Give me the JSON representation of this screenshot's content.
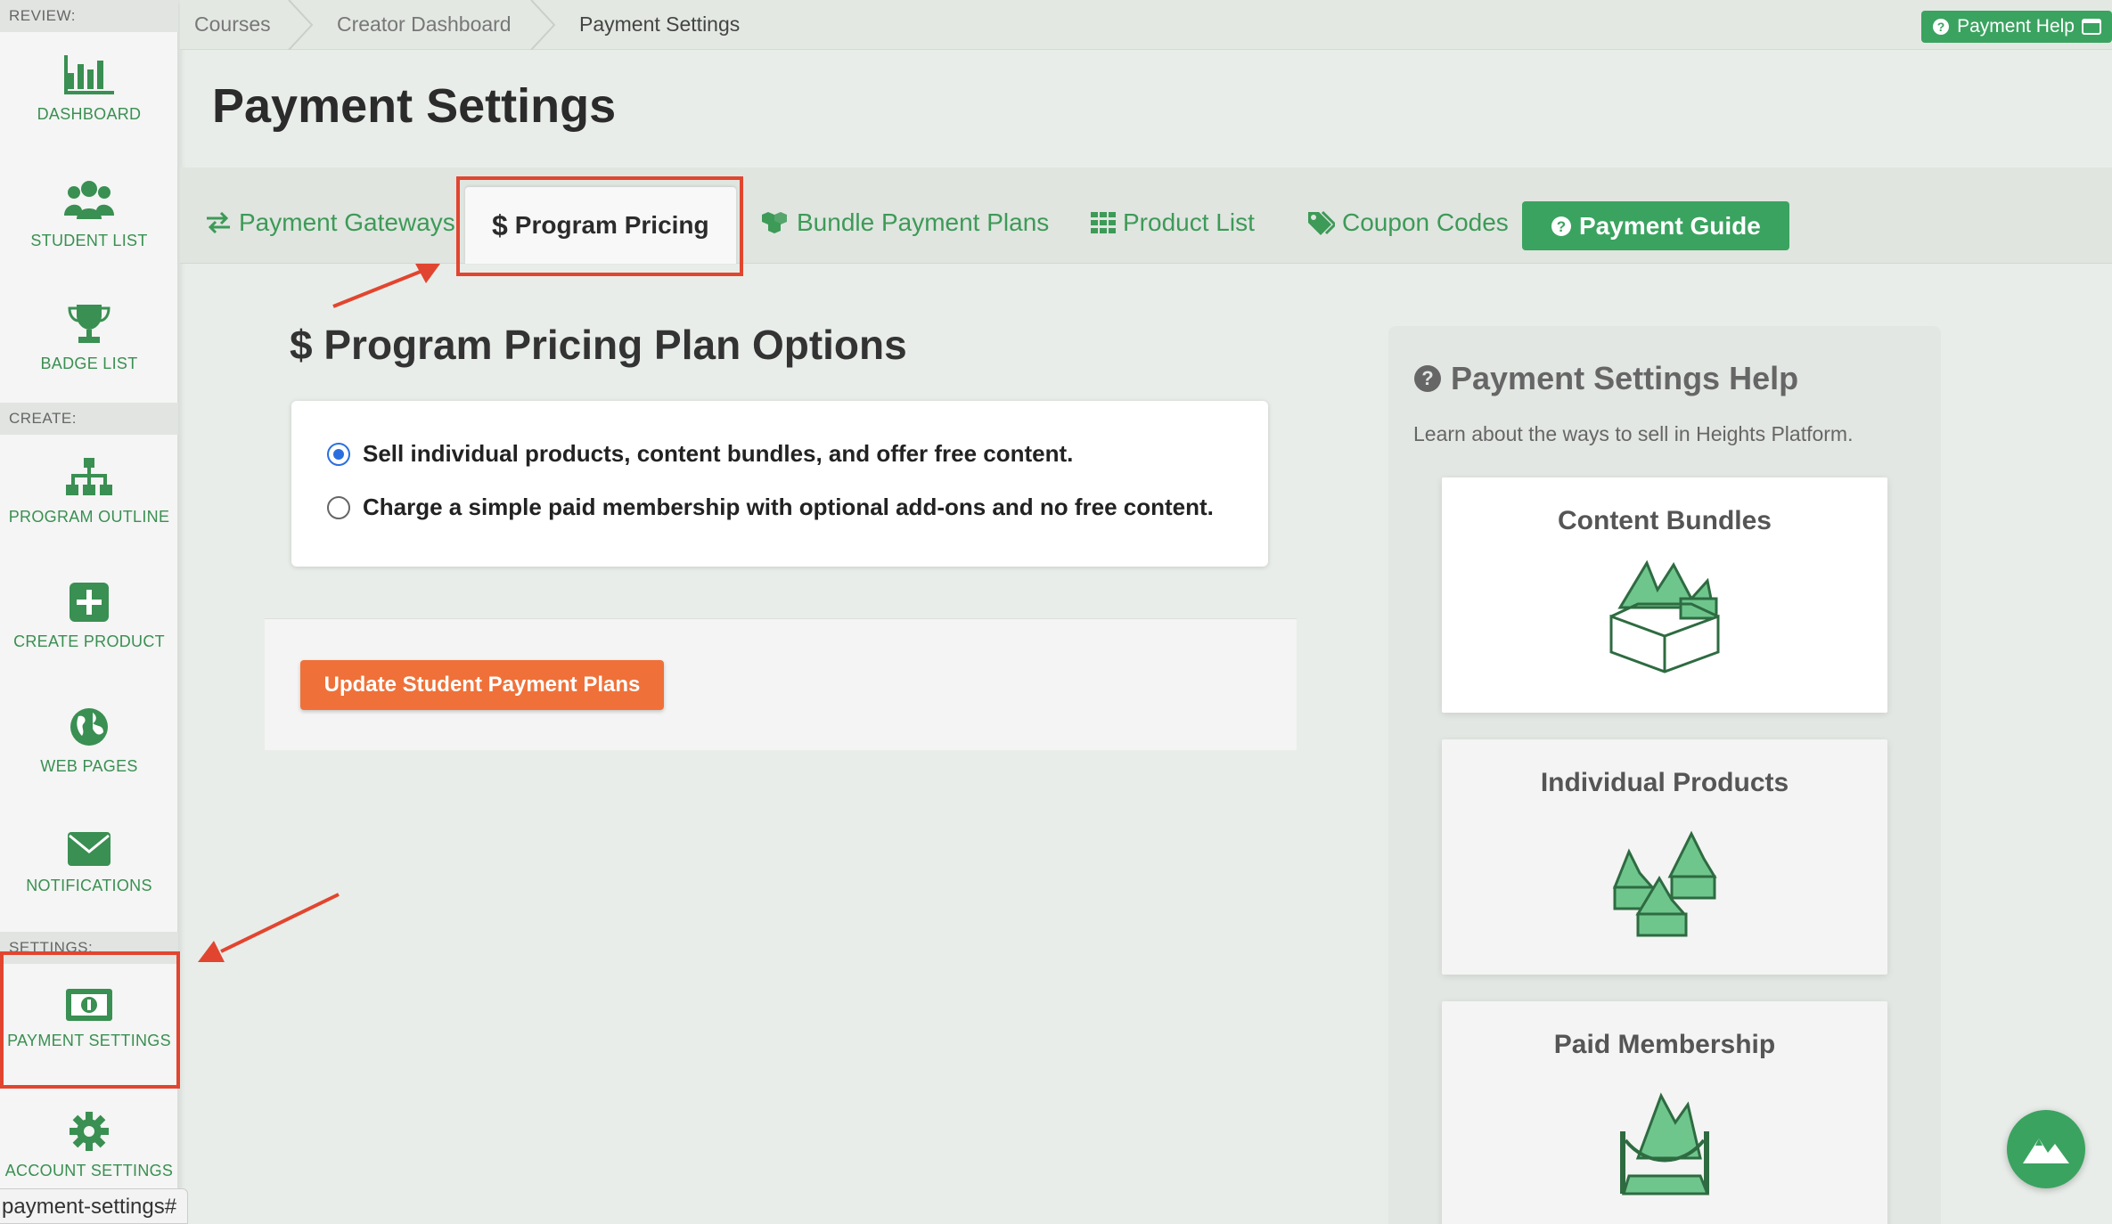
{
  "sidebar": {
    "sections": {
      "review": "REVIEW:",
      "create": "CREATE:",
      "settings": "SETTINGS:"
    },
    "items": [
      {
        "label": "DASHBOARD",
        "icon": "bar-chart-icon"
      },
      {
        "label": "STUDENT LIST",
        "icon": "users-icon"
      },
      {
        "label": "BADGE LIST",
        "icon": "trophy-icon"
      },
      {
        "label": "PROGRAM OUTLINE",
        "icon": "sitemap-icon"
      },
      {
        "label": "CREATE PRODUCT",
        "icon": "plus-square-icon"
      },
      {
        "label": "WEB PAGES",
        "icon": "globe-icon"
      },
      {
        "label": "NOTIFICATIONS",
        "icon": "envelope-icon"
      },
      {
        "label": "PAYMENT SETTINGS",
        "icon": "money-bill-icon"
      },
      {
        "label": "ACCOUNT SETTINGS",
        "icon": "gear-icon"
      }
    ]
  },
  "breadcrumb": [
    "Courses",
    "Creator Dashboard",
    "Payment Settings"
  ],
  "header": {
    "help_label": "Payment Help",
    "title": "Payment Settings"
  },
  "tabs": [
    {
      "label": "Payment Gateways",
      "icon": "exchange-icon"
    },
    {
      "label": "Program Pricing",
      "icon": "dollar-icon",
      "active": true
    },
    {
      "label": "Bundle Payment Plans",
      "icon": "cubes-icon"
    },
    {
      "label": "Product List",
      "icon": "grid-icon"
    },
    {
      "label": "Coupon Codes",
      "icon": "tags-icon"
    },
    {
      "label": "Payment Guide",
      "icon": "question-circle-icon"
    }
  ],
  "main": {
    "section_title": "Program Pricing Plan Options",
    "section_icon": "$",
    "options": [
      {
        "label": "Sell individual products, content bundles, and offer free content.",
        "checked": true
      },
      {
        "label": "Charge a simple paid membership with optional add-ons and no free content.",
        "checked": false
      }
    ],
    "update_button": "Update Student Payment Plans"
  },
  "help_panel": {
    "title": "Payment Settings Help",
    "subtitle": "Learn about the ways to sell in Heights Platform.",
    "cards": [
      {
        "title": "Content Bundles"
      },
      {
        "title": "Individual Products"
      },
      {
        "title": "Paid Membership"
      }
    ]
  },
  "status_bar": {
    "url": "payment-settings#"
  },
  "colors": {
    "brand_green": "#3aa360",
    "accent_orange": "#ef7139",
    "annotation_red": "#e2452f",
    "radio_blue": "#2a6fe0"
  }
}
